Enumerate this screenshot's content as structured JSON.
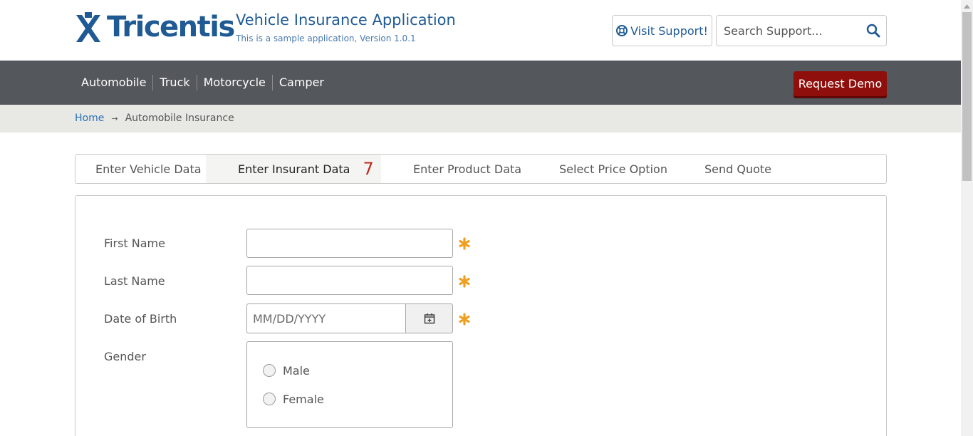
{
  "header": {
    "logo_text": "Tricentis",
    "app_title": "Vehicle Insurance Application",
    "app_subtitle": "This is a sample application, Version 1.0.1",
    "support_label": "Visit Support!",
    "search_placeholder": "Search Support...",
    "brand_color": "#1f5a94"
  },
  "nav": {
    "links": [
      "Automobile",
      "Truck",
      "Motorcycle",
      "Camper"
    ],
    "demo_label": "Request Demo",
    "bar_color": "#54575c",
    "demo_color": "#8e0f0b"
  },
  "breadcrumb": {
    "home": "Home",
    "arrow": "→",
    "current": "Automobile Insurance"
  },
  "tabs": {
    "items": [
      "Enter Vehicle Data",
      "Enter Insurant Data",
      "Enter Product Data",
      "Select Price Option",
      "Send Quote"
    ],
    "active_index": 1,
    "active_count": "7"
  },
  "form": {
    "first_name_label": "First Name",
    "last_name_label": "Last Name",
    "dob_label": "Date of Birth",
    "dob_placeholder": "MM/DD/YYYY",
    "gender_label": "Gender",
    "gender_options": [
      "Male",
      "Female"
    ],
    "required_color": "#f0a020"
  },
  "icons": {
    "support": "lifebuoy-icon",
    "search": "search-icon",
    "calendar": "calendar-icon",
    "required": "asterisk-icon"
  }
}
